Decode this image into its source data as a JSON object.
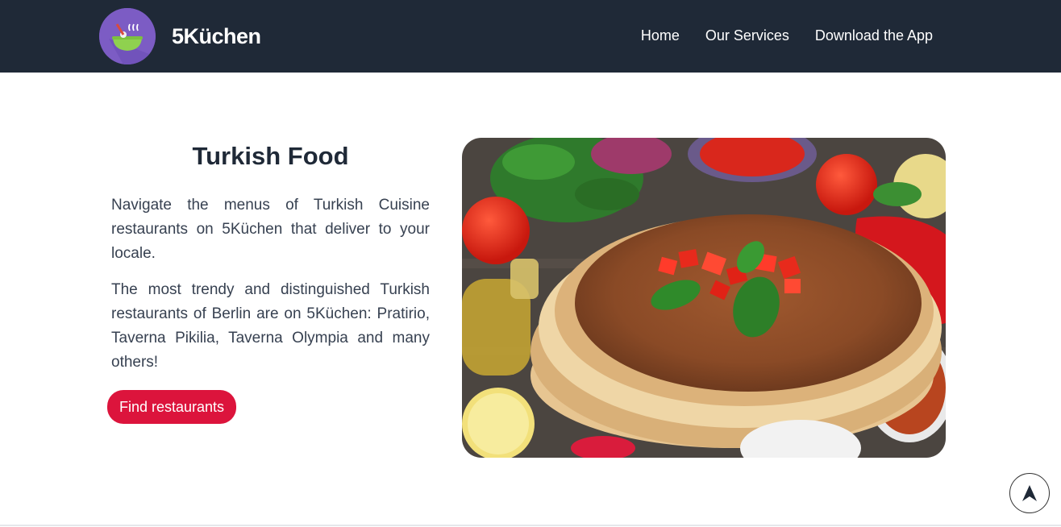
{
  "header": {
    "brand": "5Küchen",
    "logo_icon": "food-bowl-icon",
    "nav": [
      {
        "label": "Home"
      },
      {
        "label": "Our Services"
      },
      {
        "label": "Download the App"
      }
    ]
  },
  "main": {
    "title": "Turkish Food",
    "paragraphs": [
      "Navigate the menus of Turkish Cuisine restaurants on 5Küchen that deliver to your locale.",
      "The most trendy and distinguished Turkish restaurants of Berlin are on 5Küchen: Pratirio, Taverna Pikilia, Taverna Olympia and many others!"
    ],
    "cta_label": "Find restaurants",
    "image_icon": "turkish-food-photo"
  },
  "scroll_top_icon": "arrow-up-icon",
  "colors": {
    "navbar": "#1f2937",
    "accent": "#dc143c",
    "logo": "#7c5cc4"
  }
}
